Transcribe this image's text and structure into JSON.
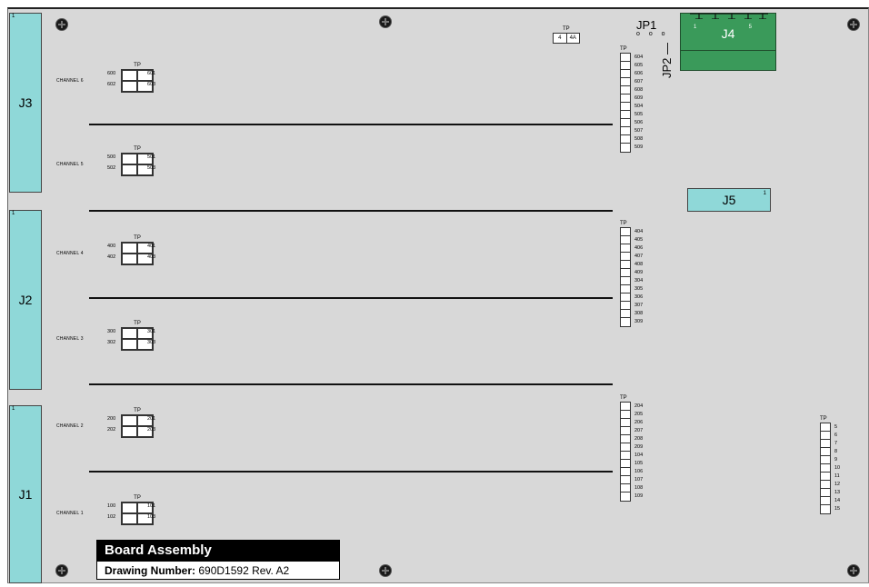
{
  "connectors": {
    "j3": {
      "label": "J3",
      "pin": "1"
    },
    "j2": {
      "label": "J2",
      "pin": "1"
    },
    "j1": {
      "label": "J1",
      "pin": "1"
    },
    "j4": {
      "label": "J4",
      "pin_first": "1",
      "pin_last": "5"
    },
    "j5": {
      "label": "J5",
      "pin": "1"
    }
  },
  "jumpers": {
    "jp1": "JP1",
    "jp1_dots": "o o o",
    "jp2": "JP2 —"
  },
  "tp_small": {
    "cap": "TP",
    "left": "4",
    "right": "4A"
  },
  "channels": [
    {
      "label": "CHANNEL 6",
      "tp": "TP",
      "pins": [
        "600",
        "601",
        "602",
        "603"
      ]
    },
    {
      "label": "CHANNEL 5",
      "tp": "TP",
      "pins": [
        "500",
        "501",
        "502",
        "503"
      ]
    },
    {
      "label": "CHANNEL 4",
      "tp": "TP",
      "pins": [
        "400",
        "401",
        "402",
        "403"
      ]
    },
    {
      "label": "CHANNEL 3",
      "tp": "TP",
      "pins": [
        "300",
        "301",
        "302",
        "303"
      ]
    },
    {
      "label": "CHANNEL 2",
      "tp": "TP",
      "pins": [
        "200",
        "201",
        "202",
        "203"
      ]
    },
    {
      "label": "CHANNEL 1",
      "tp": "TP",
      "pins": [
        "100",
        "101",
        "102",
        "103"
      ]
    }
  ],
  "strips": [
    {
      "cap": "TP",
      "pins": [
        "604",
        "605",
        "606",
        "607",
        "608",
        "609",
        "504",
        "505",
        "506",
        "507",
        "508",
        "509"
      ]
    },
    {
      "cap": "TP",
      "pins": [
        "404",
        "405",
        "406",
        "407",
        "408",
        "409",
        "304",
        "305",
        "306",
        "307",
        "308",
        "309"
      ]
    },
    {
      "cap": "TP",
      "pins": [
        "204",
        "205",
        "206",
        "207",
        "208",
        "209",
        "104",
        "105",
        "106",
        "107",
        "108",
        "109"
      ]
    },
    {
      "cap": "TP",
      "pins": [
        "5",
        "6",
        "7",
        "8",
        "9",
        "10",
        "11",
        "12",
        "13",
        "14",
        "15"
      ]
    }
  ],
  "title_block": {
    "title": "Board Assembly",
    "drawing_label": "Drawing Number:",
    "drawing_value": "690D1592  Rev. A2"
  },
  "colors": {
    "board": "#d8d8d8",
    "connector": "#8fd8d8",
    "j4": "#3a9a5a"
  }
}
